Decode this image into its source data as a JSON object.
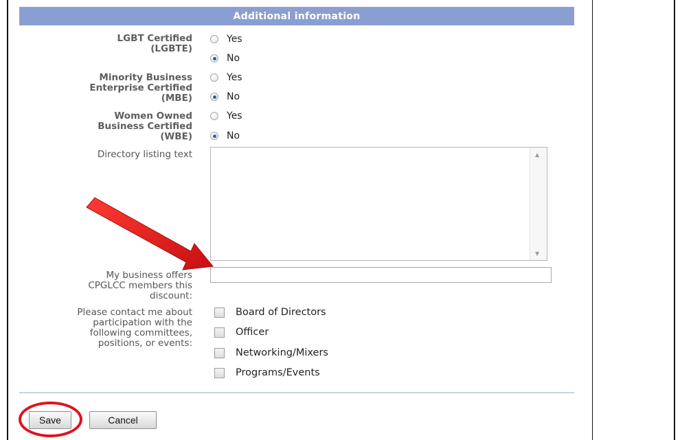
{
  "section": {
    "title": "Additional information"
  },
  "fields": {
    "lgbt": {
      "label_line1": "LGBT Certified",
      "label_line2": "(LGBTE)",
      "yes": "Yes",
      "no": "No"
    },
    "mbe": {
      "label_line1": "Minority Business",
      "label_line2": "Enterprise Certified",
      "label_line3": "(MBE)",
      "yes": "Yes",
      "no": "No"
    },
    "wbe": {
      "label_line1": "Women Owned",
      "label_line2": "Business Certified",
      "label_line3": "(WBE)",
      "yes": "Yes",
      "no": "No"
    },
    "directory": {
      "label": "Directory listing text",
      "value": ""
    },
    "discount": {
      "label_line1": "My business offers",
      "label_line2": "CPGLCC members this",
      "label_line3": "discount:",
      "value": ""
    },
    "contact": {
      "label_line1": "Please contact me about",
      "label_line2": "participation with the",
      "label_line3": "following committees,",
      "label_line4": "positions, or events:",
      "options": [
        "Board of Directors",
        "Officer",
        "Networking/Mixers",
        "Programs/Events"
      ]
    }
  },
  "buttons": {
    "save": "Save",
    "cancel": "Cancel"
  },
  "selected": {
    "lgbt": "No",
    "mbe": "No",
    "wbe": "No"
  },
  "colors": {
    "header_bg": "#8a9fd1",
    "annotation_red": "#e0121e"
  }
}
